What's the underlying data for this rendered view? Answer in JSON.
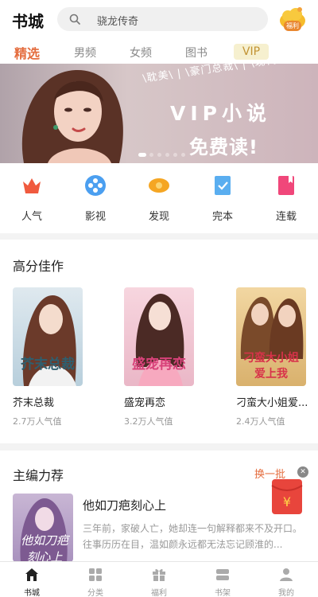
{
  "header": {
    "title": "书城",
    "search_text": "骁龙传奇",
    "welfare_label": "福利"
  },
  "tabs": [
    {
      "label": "精选",
      "active": true
    },
    {
      "label": "男频"
    },
    {
      "label": "女频"
    },
    {
      "label": "图书"
    },
    {
      "label": "VIP"
    }
  ],
  "banner": {
    "slogan": "\\耽美\\ | \\豪门总裁\\ | \\现代都市\\",
    "title_line1": "VIP小说",
    "title_line2": "免费读!",
    "slide_count": 6,
    "active_slide": 1
  },
  "quick_links": [
    {
      "label": "人气",
      "icon": "crown-icon",
      "color": "#f05a3e"
    },
    {
      "label": "影视",
      "icon": "film-icon",
      "color": "#4b9ff0"
    },
    {
      "label": "发现",
      "icon": "eye-icon",
      "color": "#f5a623"
    },
    {
      "label": "完本",
      "icon": "book-complete-icon",
      "color": "#5aaef0"
    },
    {
      "label": "连载",
      "icon": "bookmark-icon",
      "color": "#f0477a"
    }
  ],
  "high_score": {
    "title": "高分佳作",
    "books": [
      {
        "cover_title": "芥末总裁",
        "name": "芥末总裁",
        "popularity": "2.7万人气值"
      },
      {
        "cover_title": "盛宠再恋",
        "name": "盛宠再恋",
        "popularity": "3.2万人气值"
      },
      {
        "cover_title": "刁蛮大小姐爱上我",
        "name": "刁蛮大小姐爱...",
        "popularity": "2.4万人气值"
      }
    ]
  },
  "editor_pick": {
    "title": "主编力荐",
    "change_label": "换一批",
    "book": {
      "cover_title": "他如刀疤刻心上",
      "name": "他如刀疤刻心上",
      "description": "三年前，家破人亡，她却连一句解释都来不及开口。往事历历在目，温如颜永远都无法忘记顾淮的..."
    }
  },
  "tabbar": [
    {
      "label": "书城",
      "icon": "home-icon",
      "active": true
    },
    {
      "label": "分类",
      "icon": "grid-icon"
    },
    {
      "label": "福利",
      "icon": "gift-icon"
    },
    {
      "label": "书架",
      "icon": "bookshelf-icon"
    },
    {
      "label": "我的",
      "icon": "person-icon"
    }
  ]
}
